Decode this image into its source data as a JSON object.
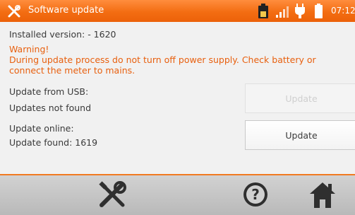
{
  "header": {
    "title": "Software update",
    "time": "07:12",
    "accent_color": "#f36d12",
    "status_icons": [
      "battery-level-icon",
      "signal-icon",
      "power-plug-icon",
      "battery-icon"
    ]
  },
  "main": {
    "installed_version": "Installed version: - 1620",
    "warning_title": "Warning!",
    "warning_line1": "During update process do not turn off power supply. Check battery or",
    "warning_line2": "connect the meter to mains.",
    "usb_label": "Update from USB:",
    "usb_status": "Updates not found",
    "usb_button_label": "Update",
    "online_label": "Update online:",
    "online_status": "Update found: 1619",
    "online_button_label": "Update"
  },
  "footer": {
    "icons": [
      "tools-icon",
      "help-icon",
      "home-icon"
    ]
  }
}
